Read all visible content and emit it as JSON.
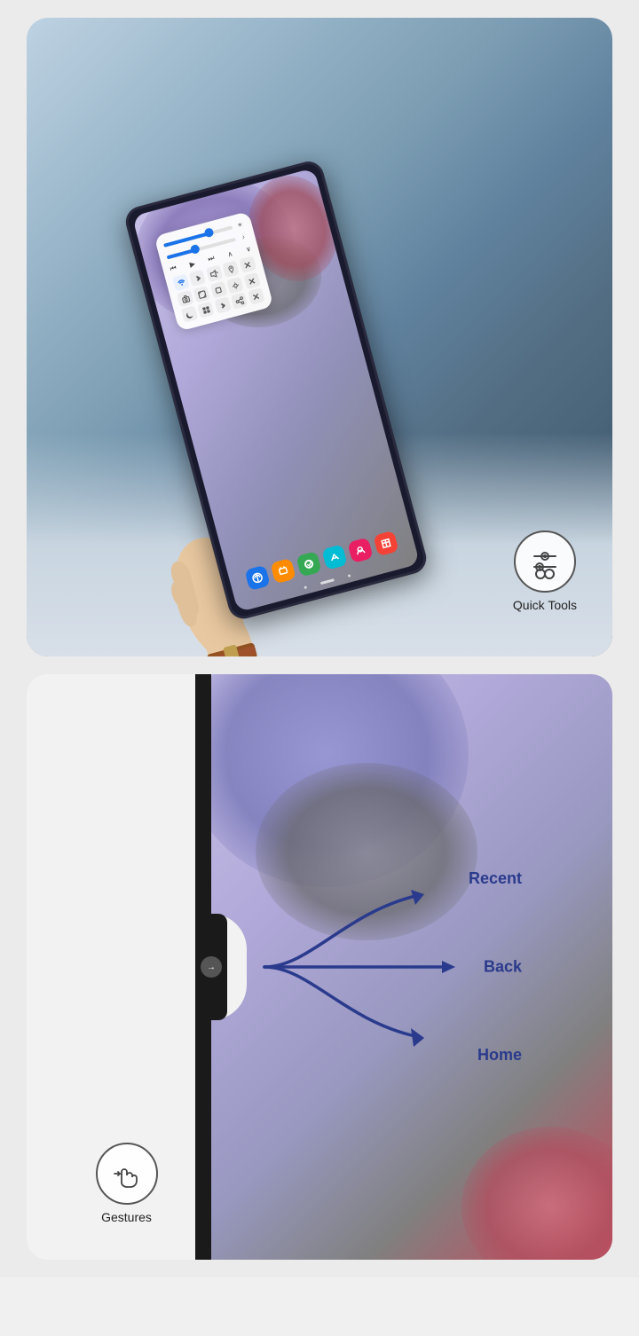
{
  "cards": {
    "quickTools": {
      "badgeLabel": "Quick Tools",
      "sliders": [
        {
          "fillPct": 65,
          "thumbLeft": "60%"
        },
        {
          "fillPct": 40,
          "thumbLeft": "37%"
        }
      ],
      "controls": [
        "⏮",
        "▶",
        "⏭",
        "∧",
        "∨"
      ],
      "icons": [
        "wifi",
        "bt",
        "vol",
        "loc",
        "x",
        "cam",
        "crop",
        "sq",
        "sq",
        "sq",
        "moon",
        "sq",
        "bt2",
        "sq",
        "x2"
      ],
      "apps": [
        {
          "color": "#1a73e8"
        },
        {
          "color": "#ff8c00"
        },
        {
          "color": "#34a853"
        },
        {
          "color": "#00bcd4"
        },
        {
          "color": "#e91e63"
        },
        {
          "color": "#f44336"
        }
      ]
    },
    "gestures": {
      "badgeLabel": "Gestures",
      "labels": {
        "recent": "Recent",
        "back": "Back",
        "home": "Home"
      },
      "arrowColor": "#2a3a8c",
      "swipeArrow": "→"
    }
  }
}
